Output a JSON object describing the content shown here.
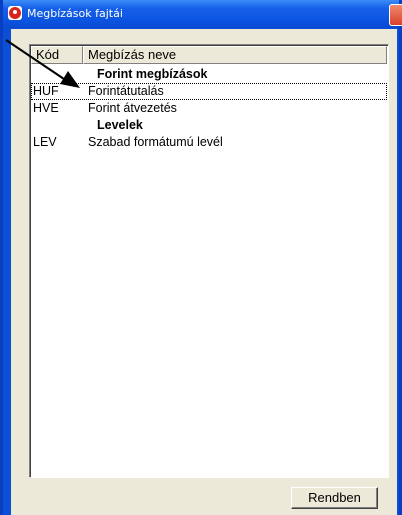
{
  "window": {
    "title": "Megbízások fajtái"
  },
  "table": {
    "headers": {
      "code": "Kód",
      "name": "Megbízás neve"
    },
    "rows": [
      {
        "code": "",
        "name": "Forint megbízások",
        "group": true
      },
      {
        "code": "HUF",
        "name": "Forintátutalás",
        "focused": true
      },
      {
        "code": "HVE",
        "name": "Forint átvezetés"
      },
      {
        "code": "",
        "name": "Levelek",
        "group": true
      },
      {
        "code": "LEV",
        "name": "Szabad formátumú levél"
      }
    ]
  },
  "footer": {
    "ok_label": "Rendben"
  },
  "annotation": {
    "pointer": "arrow-pointer-icon"
  },
  "colors": {
    "titlebar": "#0b55e2",
    "face": "#ece9d8",
    "arrow": "#000000",
    "close": "#d8412b"
  }
}
